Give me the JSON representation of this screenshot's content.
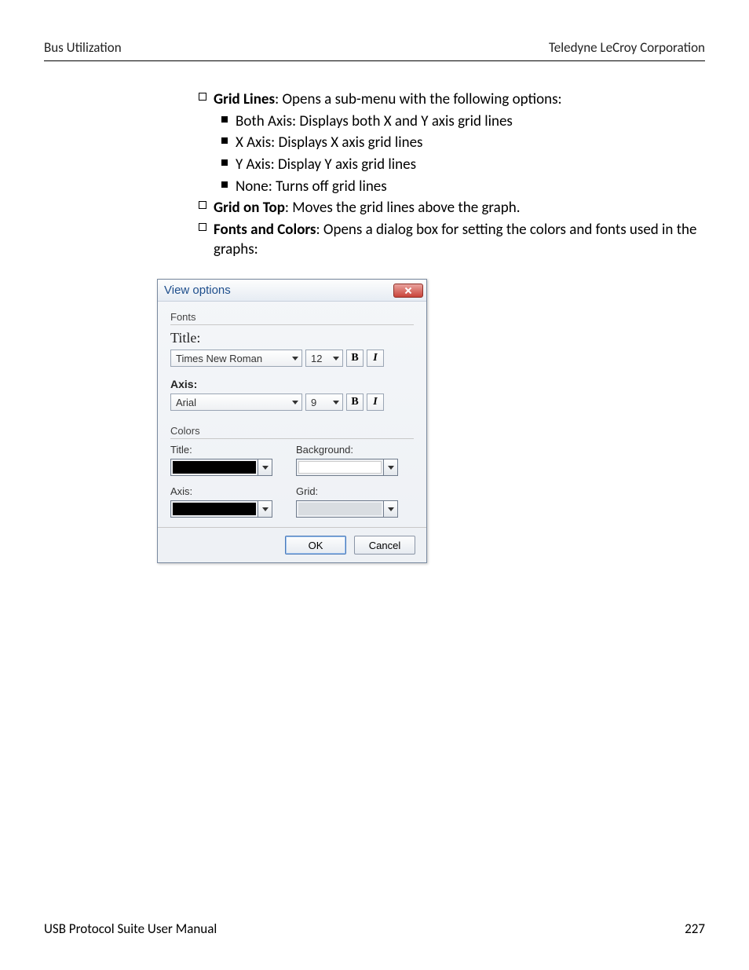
{
  "header": {
    "left": "Bus Utilization",
    "right": "Teledyne  LeCroy Corporation"
  },
  "list": {
    "gridLines": {
      "title": "Grid Lines",
      "desc": ": Opens a sub-menu with the following options:"
    },
    "sub": [
      "Both Axis: Displays both X and Y axis grid lines",
      "X Axis: Displays X axis grid lines",
      "Y Axis: Display Y axis grid lines",
      "None: Turns off grid lines"
    ],
    "gridOnTop": {
      "title": "Grid on Top",
      "desc": ": Moves the grid lines above the graph."
    },
    "fontsColors": {
      "title": "Fonts and Colors",
      "desc": ": Opens a dialog box for setting the colors and fonts used in the graphs:"
    }
  },
  "dialog": {
    "title": "View options",
    "fontsLabel": "Fonts",
    "titleLabel": "Title:",
    "titleFont": "Times New Roman",
    "titleSize": "12",
    "axisLabel": "Axis:",
    "axisFont": "Arial",
    "axisSize": "9",
    "bold": "B",
    "italic": "I",
    "colorsLabel": "Colors",
    "cTitle": "Title:",
    "cBackground": "Background:",
    "cAxis": "Axis:",
    "cGrid": "Grid:",
    "ok": "OK",
    "cancel": "Cancel"
  },
  "footer": {
    "left": "USB Protocol Suite User Manual",
    "right": "227"
  }
}
